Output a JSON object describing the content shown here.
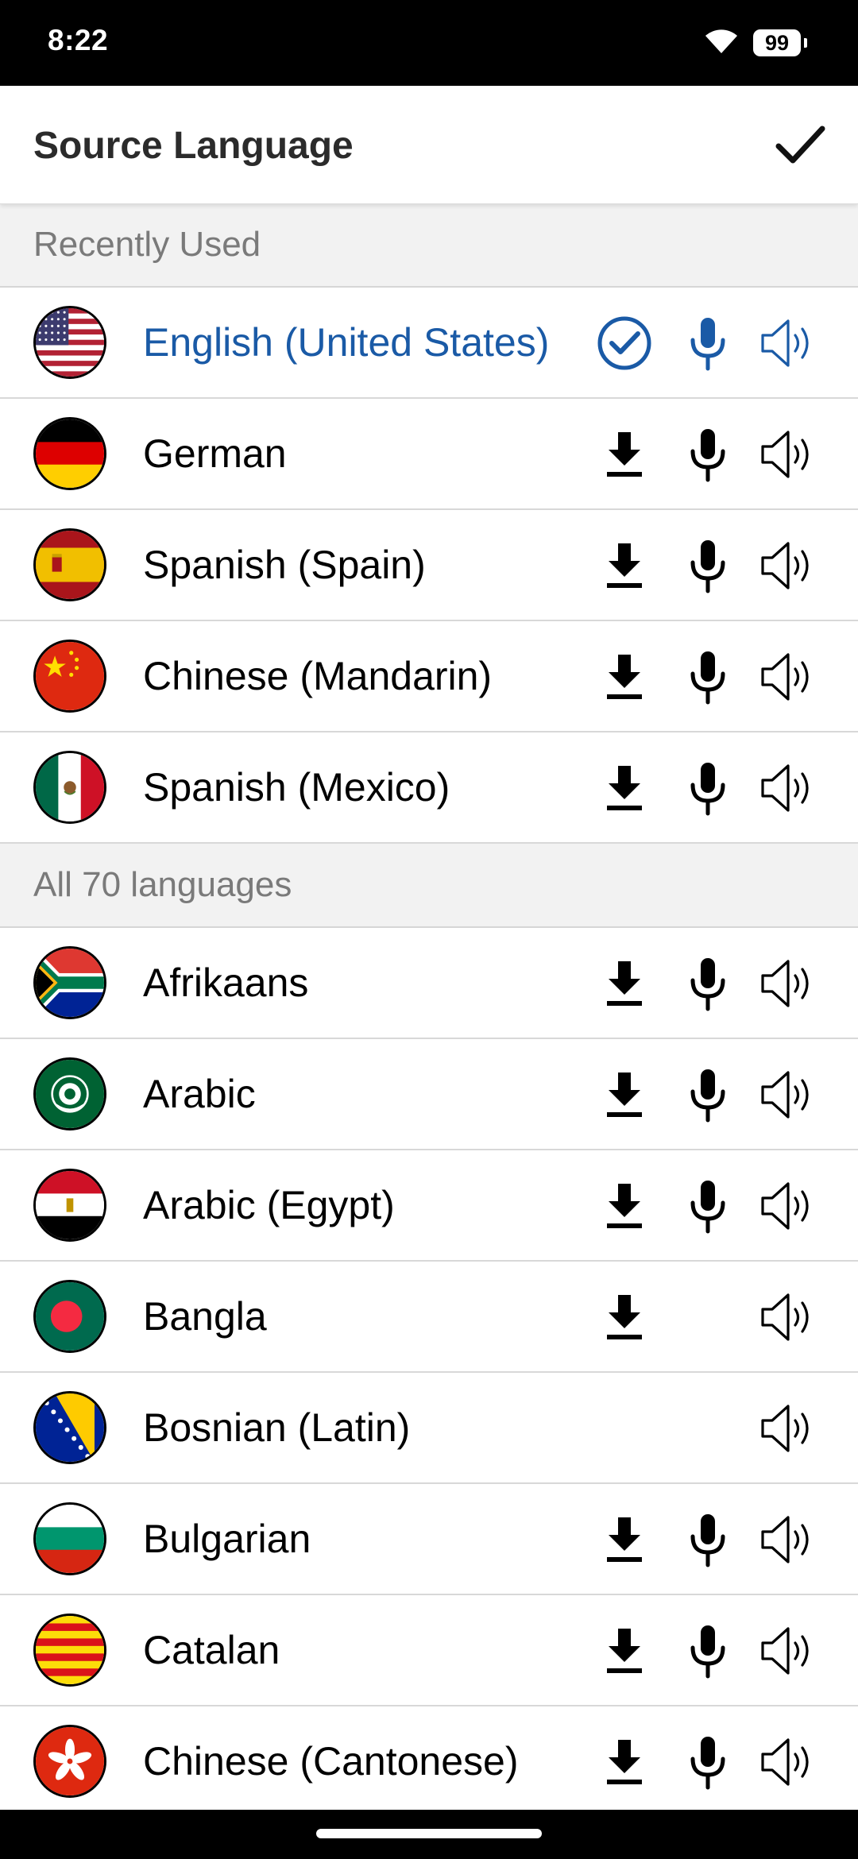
{
  "status_bar": {
    "time": "8:22",
    "battery": "99"
  },
  "header": {
    "title": "Source Language"
  },
  "sections": [
    {
      "title": "Recently Used",
      "items": [
        {
          "name": "English (United States)",
          "flag": "us",
          "active": true,
          "download": false,
          "selected": true,
          "mic": true,
          "speaker": true
        },
        {
          "name": "German",
          "flag": "de",
          "download": true,
          "mic": true,
          "speaker": true
        },
        {
          "name": "Spanish (Spain)",
          "flag": "es",
          "download": true,
          "mic": true,
          "speaker": true
        },
        {
          "name": "Chinese (Mandarin)",
          "flag": "cn",
          "download": true,
          "mic": true,
          "speaker": true
        },
        {
          "name": "Spanish (Mexico)",
          "flag": "mx",
          "download": true,
          "mic": true,
          "speaker": true
        }
      ]
    },
    {
      "title": "All 70 languages",
      "items": [
        {
          "name": "Afrikaans",
          "flag": "za",
          "download": true,
          "mic": true,
          "speaker": true
        },
        {
          "name": "Arabic",
          "flag": "arab-league",
          "download": true,
          "mic": true,
          "speaker": true
        },
        {
          "name": "Arabic (Egypt)",
          "flag": "eg",
          "download": true,
          "mic": true,
          "speaker": true
        },
        {
          "name": "Bangla",
          "flag": "bd",
          "download": true,
          "mic": false,
          "speaker": true
        },
        {
          "name": "Bosnian (Latin)",
          "flag": "ba",
          "download": false,
          "mic": false,
          "speaker": true
        },
        {
          "name": "Bulgarian",
          "flag": "bg",
          "download": true,
          "mic": true,
          "speaker": true
        },
        {
          "name": "Catalan",
          "flag": "catalonia",
          "download": true,
          "mic": true,
          "speaker": true
        },
        {
          "name": "Chinese (Cantonese)",
          "flag": "hk",
          "download": true,
          "mic": true,
          "speaker": true
        }
      ]
    }
  ],
  "colors": {
    "accent": "#1a5aa6",
    "section_bg": "#f2f2f2",
    "section_text": "#7a7a7a"
  },
  "icons": {
    "download": "download-icon",
    "mic": "microphone-icon",
    "speaker": "speaker-icon",
    "selected": "check-circle-icon",
    "done": "checkmark-icon"
  }
}
